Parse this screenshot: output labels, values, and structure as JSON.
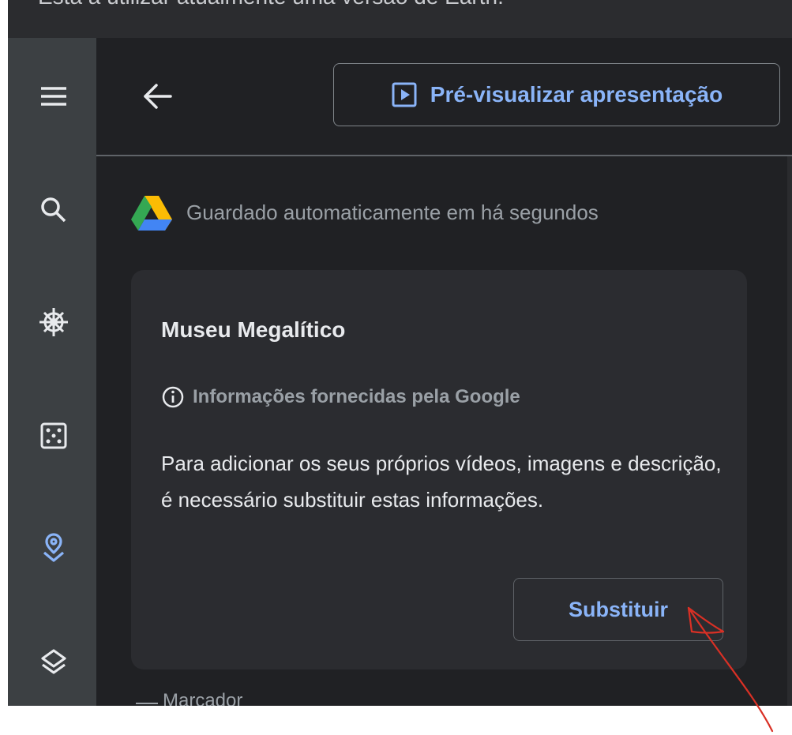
{
  "top_strip_text": "Está a utilizar atualmente uma versão de Earth.",
  "header": {
    "preview_label": "Pré-visualizar apresentação"
  },
  "sidebar": {
    "items": [
      {
        "icon": "menu-icon"
      },
      {
        "icon": "search-icon"
      },
      {
        "icon": "ship-wheel-icon"
      },
      {
        "icon": "dice-icon"
      },
      {
        "icon": "location-pin-icon",
        "active": true
      },
      {
        "icon": "layers-icon"
      }
    ]
  },
  "status": {
    "save_text": "Guardado automaticamente em há segundos"
  },
  "card": {
    "title": "Museu Megalítico",
    "info_label": "Informações fornecidas pela Google",
    "description": "Para adicionar os seus próprios vídeos, imagens e descrição, é necessário substituir estas informações.",
    "replace_label": "Substituir"
  },
  "marker_label": "Marcador",
  "colors": {
    "accent": "#8ab4f8",
    "sidebar_bg": "#3c4043",
    "main_bg": "#202124",
    "card_bg": "#2b2c30",
    "annotation": "#d93025"
  }
}
